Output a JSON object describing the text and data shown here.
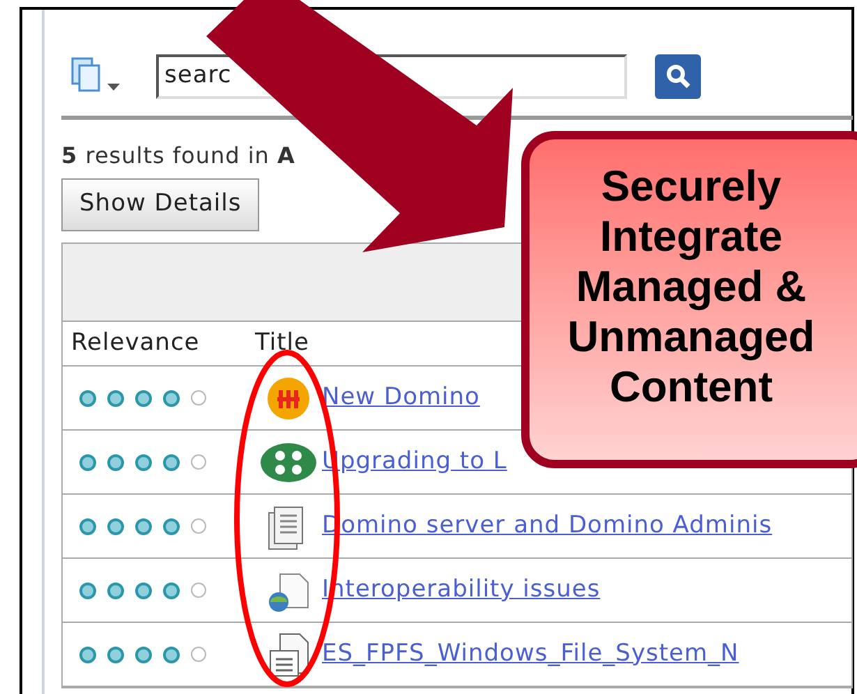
{
  "search": {
    "value": "searc"
  },
  "results_summary": [
    "**5** results found in **A**"
  ],
  "show_details_button": {
    "label": "Show Details"
  },
  "table": {
    "columns": [
      "Relevance",
      "Title"
    ],
    "rows": [
      {
        "stars": 4,
        "kind": "orange-badge",
        "title": "New Domino"
      },
      {
        "stars": 4,
        "kind": "green-badge",
        "title": "Upgrading to L"
      },
      {
        "stars": 4,
        "kind": "documents",
        "title": "Domino server and Domino Adminis"
      },
      {
        "stars": 4,
        "kind": "globe-document",
        "title": "Interoperability issues"
      },
      {
        "stars": 4,
        "kind": "document",
        "title": "ES_FPFS_Windows_File_System_N"
      }
    ]
  },
  "callout": {
    "lines": [
      "Securely",
      "Integrate",
      "Managed &",
      "Unmanaged",
      "Content"
    ]
  }
}
